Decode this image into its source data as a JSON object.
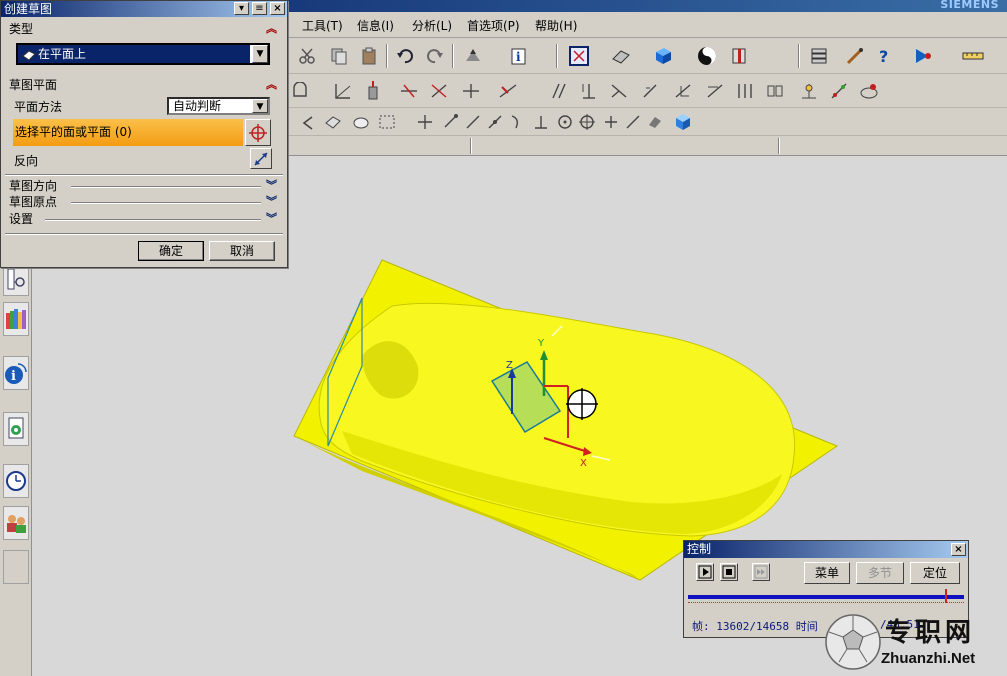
{
  "app": {
    "brand_text": "SIEMENS",
    "menus": [
      "工具(T)",
      "信息(I)",
      "分析(L)",
      "首选项(P)",
      "帮助(H)"
    ]
  },
  "dialog": {
    "title": "创建草图",
    "type_group": {
      "header": "类型",
      "selected_type": "在平面上"
    },
    "plane_group": {
      "header": "草图平面",
      "method_label": "平面方法",
      "method_value": "自动判断",
      "select_label": "选择平的面或平面 (0)",
      "reverse_label": "反向"
    },
    "collapsed_groups": [
      "草图方向",
      "草图原点",
      "设置"
    ],
    "ok_label": "确定",
    "cancel_label": "取消"
  },
  "control_panel": {
    "title": "控制",
    "menu_label": "菜单",
    "multi_label": "多节",
    "locate_label": "定位",
    "frame_text": "帧: 13602/14658 时间",
    "time_text": "/48:51",
    "progress": 0.93
  },
  "viewport": {
    "axis_labels": {
      "x": "X",
      "y": "Y",
      "z": "Z"
    }
  },
  "watermark": {
    "title": "专职网",
    "url": "Zhuanzhi.Net"
  },
  "colors": {
    "title_active": "#0a246a",
    "highlight_orange": "#f7a21b",
    "model_yellow": "#f5f500",
    "progress_blue": "#1010c0"
  }
}
